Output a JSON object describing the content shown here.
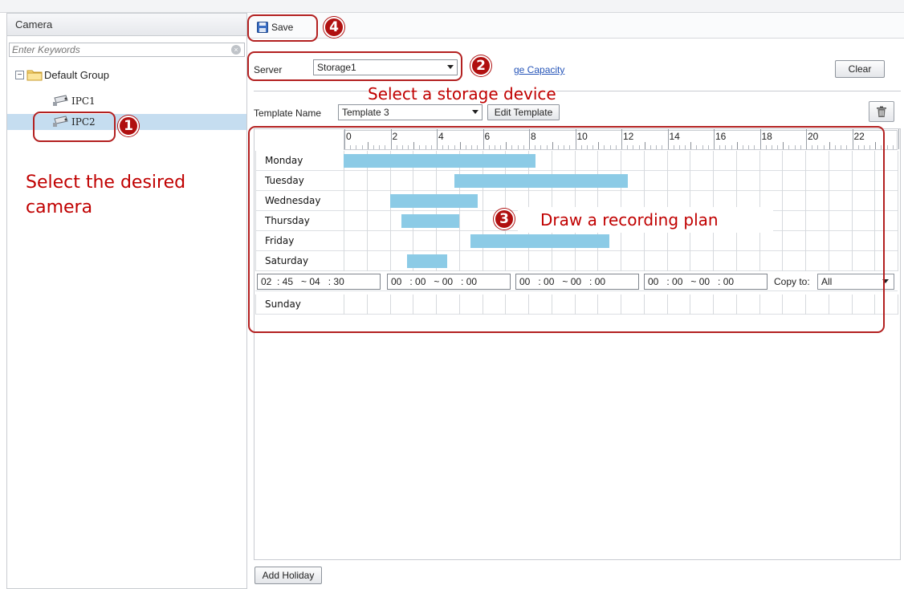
{
  "left_pane": {
    "header": "Camera",
    "search_placeholder": "Enter Keywords",
    "tree": {
      "group_label": "Default Group",
      "items": [
        {
          "label": "IPC1",
          "selected": false
        },
        {
          "label": "IPC2",
          "selected": true
        }
      ]
    }
  },
  "toolbar": {
    "save_label": "Save"
  },
  "server_row": {
    "label": "Server",
    "selected_server": "Storage1",
    "link_text": "ge Capacity",
    "clear_label": "Clear"
  },
  "template_row": {
    "label": "Template Name",
    "selected_template": "Template 3",
    "edit_label": "Edit Template"
  },
  "schedule": {
    "hour_labels": [
      "0",
      "2",
      "4",
      "6",
      "8",
      "10",
      "12",
      "14",
      "16",
      "18",
      "20",
      "22"
    ],
    "days": [
      {
        "name": "Monday",
        "segments": [
          [
            0.0,
            8.3
          ]
        ]
      },
      {
        "name": "Tuesday",
        "segments": [
          [
            4.8,
            12.3
          ]
        ]
      },
      {
        "name": "Wednesday",
        "segments": [
          [
            2.0,
            5.8
          ]
        ]
      },
      {
        "name": "Thursday",
        "segments": [
          [
            2.5,
            5.0
          ]
        ]
      },
      {
        "name": "Friday",
        "segments": [
          [
            5.5,
            11.5
          ]
        ]
      },
      {
        "name": "Saturday",
        "segments": [
          [
            2.75,
            4.5
          ]
        ]
      }
    ],
    "sunday": {
      "name": "Sunday",
      "segments": []
    },
    "time_slots": [
      "02  : 45   ~ 04   : 30",
      "00   : 00   ~ 00   : 00",
      "00   : 00   ~ 00   : 00",
      "00   : 00   ~ 00   : 00"
    ],
    "copy_to_label": "Copy to:",
    "copy_to_value": "All"
  },
  "add_holiday_label": "Add Holiday",
  "annotations": {
    "step1": "1",
    "step2": "2",
    "step3": "3",
    "step4": "4",
    "select_camera": "Select the desired camera",
    "select_storage": "Select a storage device",
    "draw_plan": "Draw a recording plan",
    "color": "#c00000"
  },
  "colors": {
    "schedule_bar": "#8ccbe6",
    "selected_row": "#c5ddf0",
    "link": "#2554b8"
  }
}
